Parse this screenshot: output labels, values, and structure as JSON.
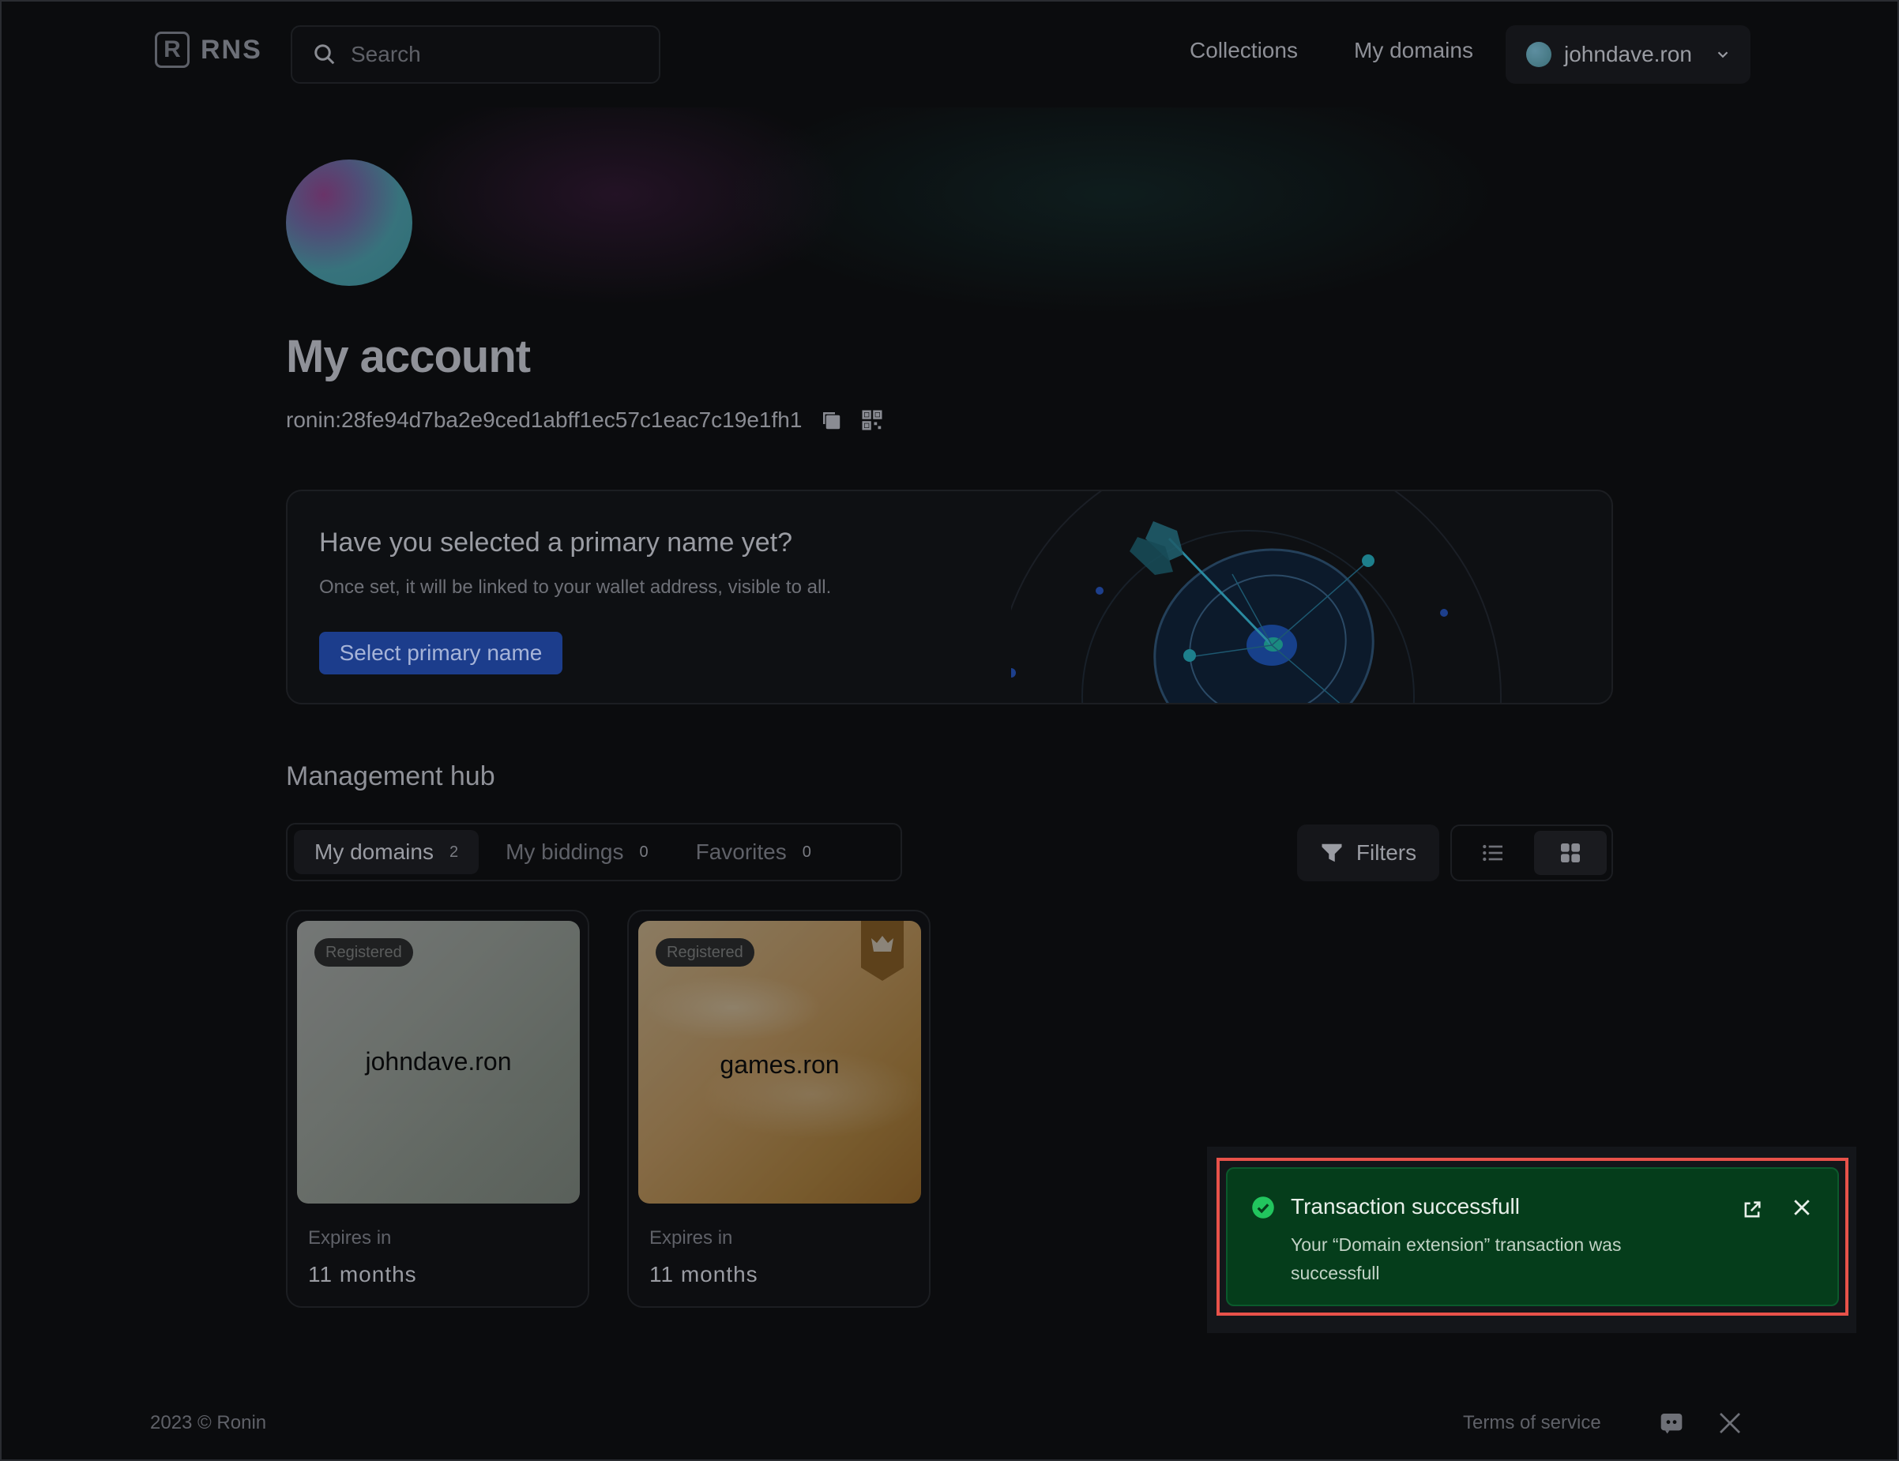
{
  "header": {
    "brand": "RNS",
    "logo_letter": "R",
    "search_placeholder": "Search",
    "nav": {
      "collections": "Collections",
      "my_domains": "My domains"
    },
    "account_name": "johndave.ron"
  },
  "profile": {
    "title": "My account",
    "wallet_address": "ronin:28fe94d7ba2e9ced1abff1ec57c1eac7c19e1fh1"
  },
  "primary_card": {
    "title": "Have you selected a primary name yet?",
    "description": "Once set, it will be linked to your wallet address, visible to all.",
    "button": "Select primary name"
  },
  "hub": {
    "title": "Management hub",
    "tabs": [
      {
        "label": "My domains",
        "count": "2"
      },
      {
        "label": "My biddings",
        "count": "0"
      },
      {
        "label": "Favorites",
        "count": "0"
      }
    ],
    "filters_label": "Filters"
  },
  "domains": [
    {
      "name": "johndave.ron",
      "status": "Registered",
      "expires_label": "Expires in",
      "expires_value": "11 months"
    },
    {
      "name": "games.ron",
      "status": "Registered",
      "expires_label": "Expires in",
      "expires_value": "11 months"
    }
  ],
  "toast": {
    "title": "Transaction successfull",
    "message": "Your “Domain extension” transaction was successfull"
  },
  "footer": {
    "copyright": "2023 © Ronin",
    "terms": "Terms of service"
  },
  "colors": {
    "background": "#0b0c0e",
    "primary_button": "#1c3d8c",
    "toast_bg": "#053d1b",
    "success": "#22c55e",
    "highlight": "#e8524a"
  },
  "icons": [
    "search-icon",
    "chevron-down-icon",
    "copy-icon",
    "qr-code-icon",
    "filter-icon",
    "list-view-icon",
    "grid-view-icon",
    "crown-icon",
    "check-circle-icon",
    "external-link-icon",
    "close-icon",
    "discord-icon",
    "x-twitter-icon"
  ]
}
